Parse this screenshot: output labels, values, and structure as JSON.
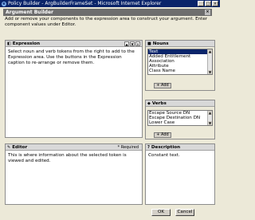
{
  "window": {
    "title": "Policy Builder - ArgBuilderFrameSet - Microsoft Internet Explorer",
    "ie_icon": "e"
  },
  "builder": {
    "title": "Argument Builder",
    "instructions": "Add or remove your components to the expression area to construct your argument. Enter component values under Editor."
  },
  "expression": {
    "title": "Expression",
    "body": "Select noun and verb tokens from the right to add to the Expression area. Use the buttons in the Expression caption to re-arrange or remove them."
  },
  "nouns": {
    "title": "Nouns",
    "items": [
      "Text",
      "Added Entitlement",
      "Association",
      "Attribute",
      "Class Name"
    ],
    "selected_index": 0,
    "add_label": "+ Add"
  },
  "verbs": {
    "title": "Verbs",
    "items": [
      "Escape Source DN",
      "Escape Destination DN",
      "Lower Case"
    ],
    "add_label": "+ Add"
  },
  "editor": {
    "title": "Editor",
    "required_label": "* Required",
    "body": "This is where information about the selected token is viewed and edited."
  },
  "description": {
    "title": "Description",
    "body": "Constant text."
  },
  "buttons": {
    "ok": "OK",
    "cancel": "Cancel"
  }
}
